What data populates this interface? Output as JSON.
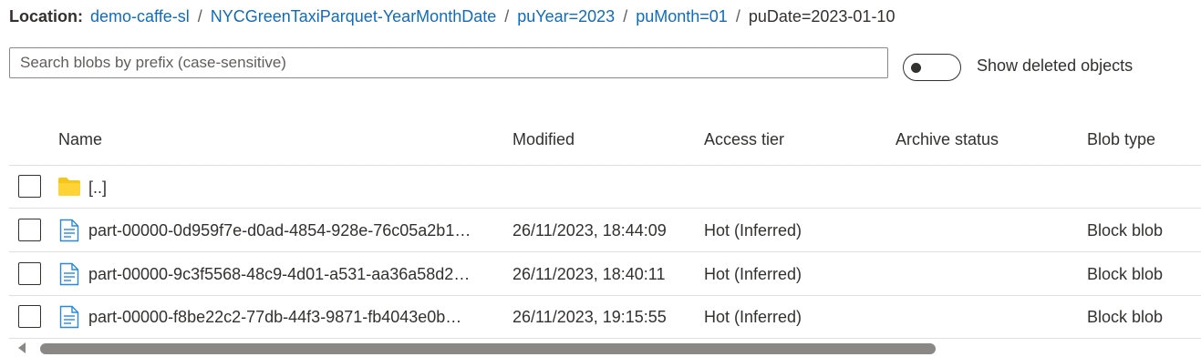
{
  "location": {
    "label": "Location:",
    "crumbs": [
      "demo-caffe-sl",
      "NYCGreenTaxiParquet-YearMonthDate",
      "puYear=2023",
      "puMonth=01"
    ],
    "separator": "/",
    "current": "puDate=2023-01-10"
  },
  "search": {
    "placeholder": "Search blobs by prefix (case-sensitive)",
    "value": ""
  },
  "toggle": {
    "label": "Show deleted objects",
    "checked": false
  },
  "table": {
    "headers": {
      "name": "Name",
      "modified": "Modified",
      "access_tier": "Access tier",
      "archive_status": "Archive status",
      "blob_type": "Blob type"
    },
    "parent_row": {
      "name": "[..]"
    },
    "rows": [
      {
        "name": "part-00000-0d959f7e-d0ad-4854-928e-76c05a2b1…",
        "modified": "26/11/2023, 18:44:09",
        "access_tier": "Hot (Inferred)",
        "archive_status": "",
        "blob_type": "Block blob"
      },
      {
        "name": "part-00000-9c3f5568-48c9-4d01-a531-aa36a58d2…",
        "modified": "26/11/2023, 18:40:11",
        "access_tier": "Hot (Inferred)",
        "archive_status": "",
        "blob_type": "Block blob"
      },
      {
        "name": "part-00000-f8be22c2-77db-44f3-9871-fb4043e0b…",
        "modified": "26/11/2023, 19:15:55",
        "access_tier": "Hot (Inferred)",
        "archive_status": "",
        "blob_type": "Block blob"
      }
    ]
  },
  "icons": {
    "folder": "folder-icon",
    "file": "document-icon",
    "scroll_left": "scroll-left-arrow-icon"
  },
  "colors": {
    "link": "#0f6cbd",
    "text": "#323130",
    "folder": "#f5c518",
    "file": "#2b88d8"
  }
}
